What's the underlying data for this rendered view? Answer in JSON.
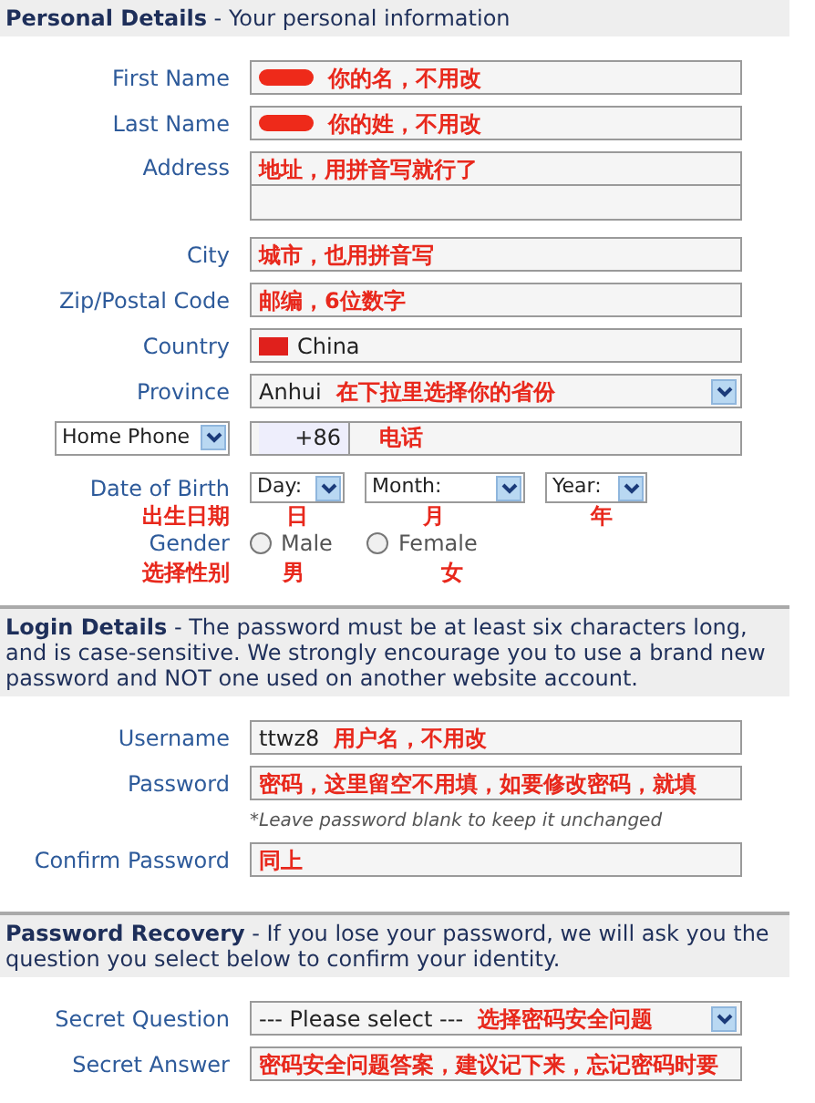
{
  "sections": [
    {
      "heading": "**Personal Details** - Your personal information",
      "rows": [
        {
          "kind": "text",
          "label": "First Name",
          "redacted": true,
          "note": "你的名，不用改"
        },
        {
          "kind": "text",
          "label": "Last Name",
          "redacted": true,
          "note": "你的姓，不用改"
        },
        {
          "kind": "address",
          "label": "Address",
          "note": "地址，用拼音写就行了"
        },
        {
          "kind": "text",
          "label": "City",
          "note": "城市，也用拼音写"
        },
        {
          "kind": "text",
          "label": "Zip/Postal Code",
          "note": "邮编，6位数字"
        },
        {
          "kind": "country",
          "label": "Country",
          "value": "China"
        },
        {
          "kind": "select",
          "label": "Province",
          "value": "Anhui",
          "note": "在下拉里选择你的省份"
        },
        {
          "kind": "phone",
          "type": "Home Phone",
          "prefix": "+86",
          "note": "电话"
        },
        {
          "kind": "dob",
          "label": "Date of Birth",
          "label_note": "出生日期",
          "selects": [
            {
              "label": "Day:",
              "note": "日"
            },
            {
              "label": "Month:",
              "note": "月"
            },
            {
              "label": "Year:",
              "note": "年"
            }
          ]
        },
        {
          "kind": "gender",
          "label": "Gender",
          "label_note": "选择性别",
          "options": [
            {
              "label": "Male",
              "note": "男",
              "selected": false
            },
            {
              "label": "Female",
              "note": "女",
              "selected": false
            }
          ]
        }
      ]
    },
    {
      "heading": "**Login Details** - The password must be at least six characters long, and is case-sensitive. We strongly encourage you to use a brand new password and NOT one used on another website account.",
      "rows": [
        {
          "kind": "text",
          "label": "Username",
          "value": "ttwz8",
          "note": "用户名，不用改"
        },
        {
          "kind": "text",
          "label": "Password",
          "note": "密码，这里留空不用填，如要修改密码，就填"
        },
        {
          "kind": "hint",
          "text": "*Leave password blank to keep it unchanged"
        },
        {
          "kind": "text",
          "label": "Confirm Password",
          "note": "同上"
        }
      ]
    },
    {
      "heading": "**Password Recovery** - If you lose your password, we will ask you the question you select below to confirm your identity.",
      "rows": [
        {
          "kind": "select",
          "label": "Secret Question",
          "value": "--- Please select ---",
          "note": "选择密码安全问题"
        },
        {
          "kind": "text",
          "label": "Secret Answer",
          "note": "密码安全问题答案，建议记下来，忘记密码时要"
        }
      ]
    }
  ]
}
